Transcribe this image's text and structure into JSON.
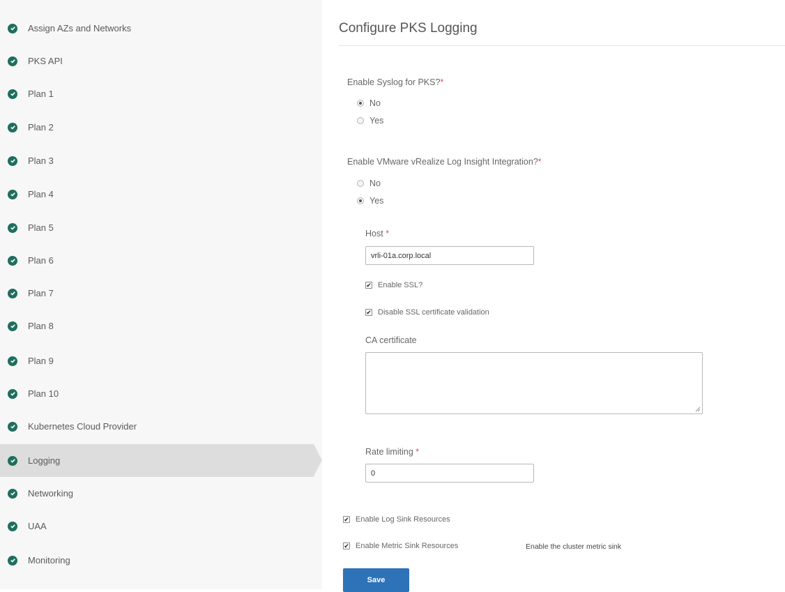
{
  "sidebar": {
    "items": [
      {
        "label": "Assign AZs and Networks",
        "active": false
      },
      {
        "label": "PKS API",
        "active": false
      },
      {
        "label": "Plan 1",
        "active": false
      },
      {
        "label": "Plan 2",
        "active": false
      },
      {
        "label": "Plan 3",
        "active": false
      },
      {
        "label": "Plan 4",
        "active": false
      },
      {
        "label": "Plan 5",
        "active": false
      },
      {
        "label": "Plan 6",
        "active": false
      },
      {
        "label": "Plan 7",
        "active": false
      },
      {
        "label": "Plan 8",
        "active": false
      },
      {
        "label": "Plan 9",
        "active": false
      },
      {
        "label": "Plan 10",
        "active": false
      },
      {
        "label": "Kubernetes Cloud Provider",
        "active": false
      },
      {
        "label": "Logging",
        "active": true
      },
      {
        "label": "Networking",
        "active": false
      },
      {
        "label": "UAA",
        "active": false
      },
      {
        "label": "Monitoring",
        "active": false
      }
    ]
  },
  "main": {
    "title": "Configure PKS Logging",
    "syslog": {
      "question": "Enable Syslog for PKS?",
      "required_mark": "*",
      "options": [
        "No",
        "Yes"
      ],
      "selected": "No"
    },
    "vrli": {
      "question": "Enable VMware vRealize Log Insight Integration?",
      "required_mark": "*",
      "options": [
        "No",
        "Yes"
      ],
      "selected": "Yes",
      "host_label": "Host",
      "host_required_mark": "*",
      "host_value": "vrli-01a.corp.local",
      "enable_ssl_label": "Enable SSL?",
      "enable_ssl_checked": true,
      "disable_ssl_validation_label": "Disable SSL certificate validation",
      "disable_ssl_validation_checked": true,
      "ca_label": "CA certificate",
      "ca_value": "",
      "rate_label": "Rate limiting",
      "rate_required_mark": "*",
      "rate_value": "0"
    },
    "log_sink_label": "Enable Log Sink Resources",
    "log_sink_checked": true,
    "metric_sink_label": "Enable Metric Sink Resources",
    "metric_sink_checked": true,
    "metric_sink_hint": "Enable the cluster metric sink",
    "save_label": "Save"
  },
  "colors": {
    "check_icon": "#1f6e5e",
    "active_item_bg": "#dddddd",
    "save_button": "#2e72b8",
    "required": "#e05050"
  }
}
